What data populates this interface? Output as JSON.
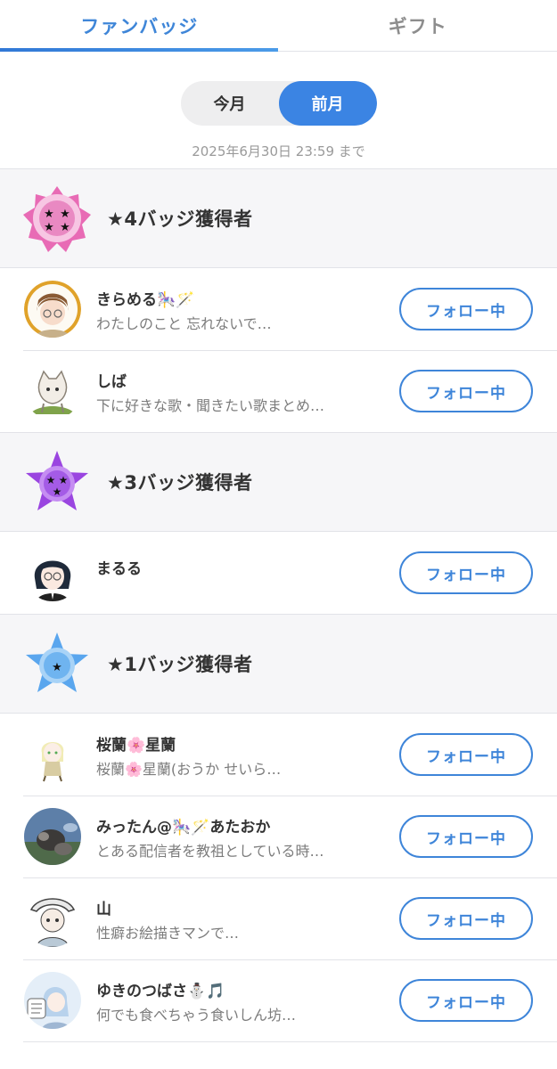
{
  "tabs": {
    "fan_badge": "ファンバッジ",
    "gift": "ギフト"
  },
  "period": {
    "this_month": "今月",
    "last_month": "前月",
    "selected": "前月"
  },
  "deadline": "2025年6月30日 23:59 まで",
  "button_label": "フォロー中",
  "colors": {
    "accent": "#3b84e3",
    "badge4": "#e86bb5",
    "badge3": "#9a45e0",
    "badge1": "#5aa6ee"
  },
  "sections": [
    {
      "title": "★4バッジ獲得者",
      "icon": "star-badge-4-icon",
      "users": [
        {
          "name": "きらめる🎠🪄",
          "bio": "わたしのこと 忘れないで…"
        },
        {
          "name": "しば",
          "bio": "下に好きな歌・聞きたい歌まとめ…"
        }
      ]
    },
    {
      "title": "★3バッジ獲得者",
      "icon": "star-badge-3-icon",
      "users": [
        {
          "name": "まるる",
          "bio": ""
        }
      ]
    },
    {
      "title": "★1バッジ獲得者",
      "icon": "star-badge-1-icon",
      "users": [
        {
          "name": "桜蘭🌸星蘭",
          "bio": "桜蘭🌸星蘭(おうか せいら…"
        },
        {
          "name": "みったん@🎠🪄あたおか",
          "bio": "とある配信者を教祖としている時…"
        },
        {
          "name": "山",
          "bio": "性癖お絵描きマンで…"
        },
        {
          "name": "ゆきのつばさ⛄🎵",
          "bio": "何でも食べちゃう食いしん坊…"
        }
      ]
    }
  ]
}
